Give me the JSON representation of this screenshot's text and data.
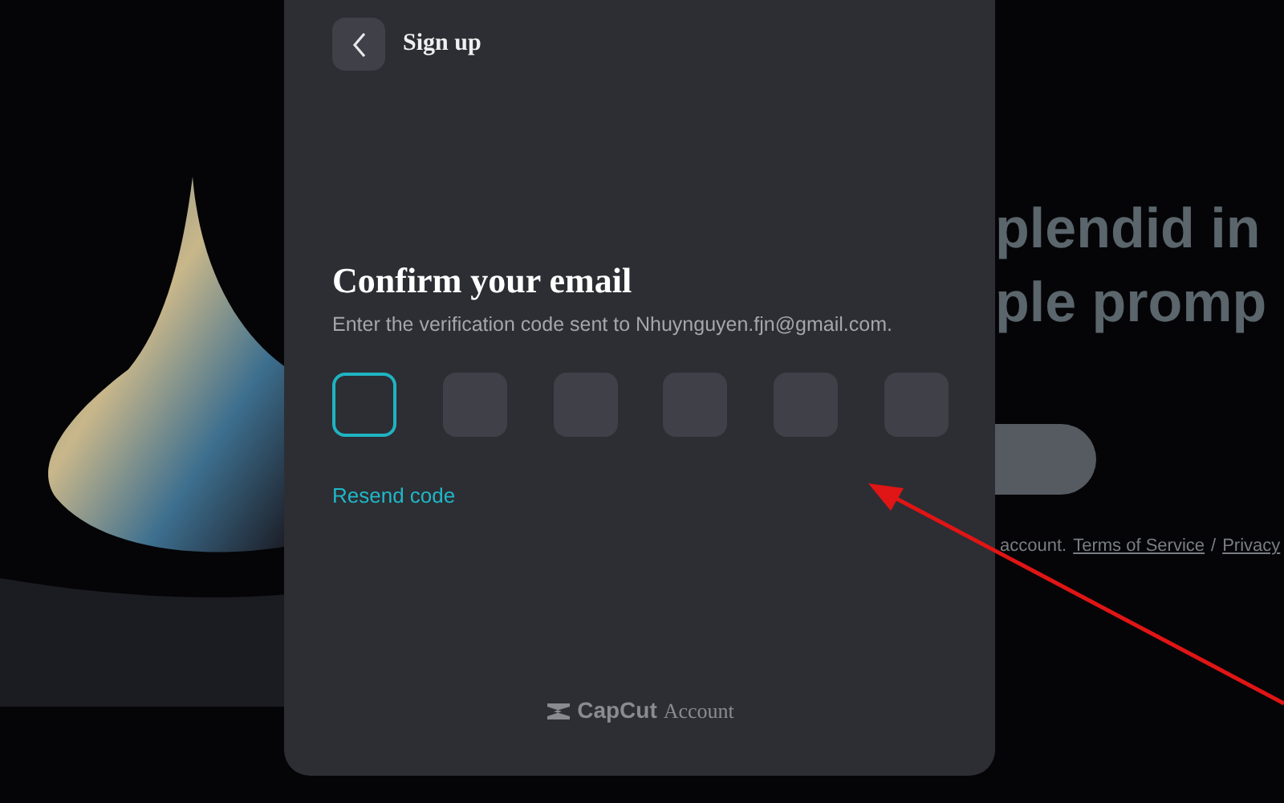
{
  "background_page": {
    "headline_lines": [
      "plendid in",
      "ple promp"
    ],
    "footer": {
      "text": "account.",
      "links": [
        "Terms of Service",
        "Privacy"
      ],
      "separator": "/"
    }
  },
  "dialog": {
    "header": {
      "title": "Sign up"
    },
    "heading": "Confirm your email",
    "instruction": "Enter the verification code sent to Nhuynguyen.fjn@gmail.com.",
    "code_boxes": [
      {
        "selected": true
      },
      {
        "selected": false
      },
      {
        "selected": false
      },
      {
        "selected": false
      },
      {
        "selected": false
      },
      {
        "selected": false
      }
    ],
    "resend_link": "Resend code",
    "brand": {
      "name": "CapCut",
      "suffix": "Account"
    }
  }
}
